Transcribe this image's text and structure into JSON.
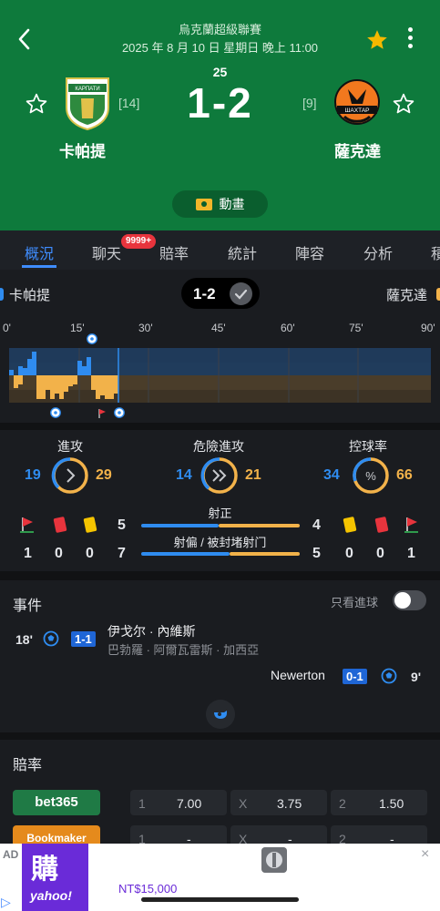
{
  "header": {
    "league": "烏克蘭超級聯賽",
    "datetime": "2025 年 8 月 10 日 星期日 晚上 11:00",
    "minute": "25",
    "score": "1-2",
    "home": {
      "name": "卡帕提",
      "rank": "[14]",
      "crest_text": "КАРПАТИ"
    },
    "away": {
      "name": "薩克達",
      "rank": "[9]",
      "crest_text": "ШАХТАР"
    },
    "animation_label": "動畫"
  },
  "tabs": {
    "items": [
      "概況",
      "聊天",
      "賠率",
      "統計",
      "陣容",
      "分析",
      "積"
    ],
    "active": 0,
    "chat_badge": "9999+"
  },
  "strip": {
    "home": "卡帕提",
    "away": "薩克達",
    "score": "1-2",
    "minute_ticks": [
      "0'",
      "15'",
      "30'",
      "45'",
      "60'",
      "75'",
      "90'"
    ]
  },
  "stats": {
    "attack_title": "進攻",
    "attack_home": "19",
    "attack_away": "29",
    "danger_title": "危險進攻",
    "danger_home": "14",
    "danger_away": "21",
    "possession_title": "控球率",
    "possession_home": "34",
    "possession_away": "66",
    "shots_on_label": "射正",
    "shots_on_home": "5",
    "shots_on_away": "4",
    "shots_off_label": "射偏 / 被封堵射门",
    "shots_off_home": "7",
    "shots_off_away": "5",
    "home_counts": {
      "corners": "1",
      "red": "0",
      "yellow": "0"
    },
    "away_counts": {
      "yellow": "0",
      "red": "0",
      "corners": "1"
    }
  },
  "events": {
    "title": "事件",
    "toggle_label": "只看進球",
    "items": [
      {
        "minute": "18'",
        "score": "1-1",
        "player": "伊戈尔 · 內維斯",
        "assist": "巴勃羅 · 阿爾瓦雷斯 · 加西亞"
      },
      {
        "minute": "9'",
        "score": "0-1",
        "player": "Newerton"
      }
    ]
  },
  "odds": {
    "title": "賠率",
    "rows": [
      {
        "book": "bet365",
        "k1": "1",
        "v1": "7.00",
        "kx": "X",
        "vx": "3.75",
        "k2": "2",
        "v2": "1.50"
      },
      {
        "book": "Bookmaker",
        "k1": "1",
        "v1": "-",
        "kx": "X",
        "vx": "-",
        "k2": "2",
        "v2": "-"
      }
    ]
  },
  "ad": {
    "tag": "AD",
    "logo_main": "購",
    "logo_sub": "yahoo!",
    "price": "NT$15,000",
    "close": "×",
    "info": "▷"
  },
  "colors": {
    "header_green": "#0e7a3c",
    "home_blue": "#2f8cf0",
    "away_orange": "#f2b24a",
    "accent_blue": "#3f8dff",
    "badge_red": "#e8343d"
  }
}
